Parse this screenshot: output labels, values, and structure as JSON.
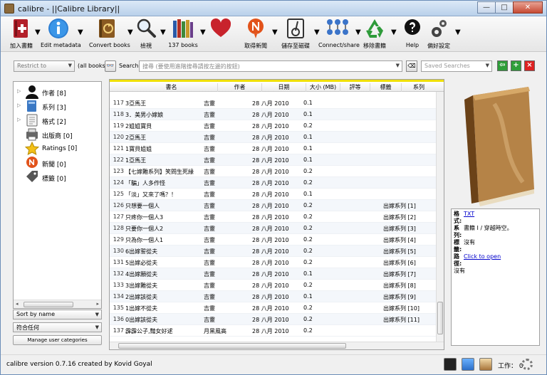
{
  "window": {
    "title": "calibre - ||Calibre Library||",
    "buttons": [
      "—",
      "□",
      "✕"
    ]
  },
  "toolbar": [
    {
      "id": "add-books",
      "label": "加入書籍",
      "icon": "add-book-icon",
      "dropdown": true
    },
    {
      "id": "edit-metadata",
      "label": "Edit metadata",
      "icon": "info-icon",
      "dropdown": true
    },
    {
      "id": "convert-books",
      "label": "Convert books",
      "icon": "convert-book-icon",
      "dropdown": true
    },
    {
      "id": "view",
      "label": "檢視",
      "icon": "magnifier-icon",
      "dropdown": true
    },
    {
      "id": "library",
      "label": "137 books",
      "icon": "bookshelf-icon",
      "dropdown": true
    },
    {
      "id": "donate",
      "label": "",
      "icon": "heart-icon",
      "dropdown": false
    },
    {
      "id": "fetch-news",
      "label": "取得新聞",
      "icon": "news-icon",
      "dropdown": true
    },
    {
      "id": "save-to-disk",
      "label": "儲存至磁碟",
      "icon": "save-disk-icon",
      "dropdown": true
    },
    {
      "id": "connect-share",
      "label": "Connect/share",
      "icon": "network-icon",
      "dropdown": true
    },
    {
      "id": "remove-books",
      "label": "移除書籍",
      "icon": "recycle-icon",
      "dropdown": true
    },
    {
      "id": "help",
      "label": "Help",
      "icon": "help-icon",
      "dropdown": false
    },
    {
      "id": "preferences",
      "label": "偏好設定",
      "icon": "gear-icon",
      "dropdown": true
    }
  ],
  "search": {
    "restrict_to": "Restrict to",
    "all_books": "(all books)",
    "label": "Search:",
    "placeholder": "搜尋 (要使用進階搜尋請按左邊的按鈕)",
    "saved_searches": "Saved Searches"
  },
  "tag_browser": [
    {
      "label": "作者 [8]",
      "icon": "person-icon",
      "expandable": true
    },
    {
      "label": "系列 [3]",
      "icon": "series-icon",
      "expandable": true
    },
    {
      "label": "格式 [2]",
      "icon": "format-icon",
      "expandable": true
    },
    {
      "label": "出版商 [0]",
      "icon": "publisher-icon",
      "expandable": false
    },
    {
      "label": "Ratings [0]",
      "icon": "star-icon",
      "expandable": false
    },
    {
      "label": "新聞 [0]",
      "icon": "news-icon",
      "expandable": false
    },
    {
      "label": "標籤 [0]",
      "icon": "tag-icon",
      "expandable": false
    }
  ],
  "left_controls": {
    "sort_by": "Sort by name",
    "match": "符合任何",
    "manage": "Manage user categories"
  },
  "columns": [
    "書名",
    "作者",
    "日期",
    "大小 (MB)",
    "評等",
    "標籤",
    "系列"
  ],
  "rows": [
    {
      "n": "117",
      "title": "3亞馬王",
      "author": "吉靈",
      "date": "28 八月 2010",
      "size": "0.1",
      "series": ""
    },
    {
      "n": "118",
      "title": "3．美男小嫁娘",
      "author": "吉靈",
      "date": "28 八月 2010",
      "size": "0.1",
      "series": ""
    },
    {
      "n": "119",
      "title": "2姐姐寶貝",
      "author": "吉靈",
      "date": "28 八月 2010",
      "size": "0.2",
      "series": ""
    },
    {
      "n": "120",
      "title": "2亞馬王",
      "author": "吉靈",
      "date": "28 八月 2010",
      "size": "0.1",
      "series": ""
    },
    {
      "n": "121",
      "title": "1寶貝姐姐",
      "author": "吉靈",
      "date": "28 八月 2010",
      "size": "0.1",
      "series": ""
    },
    {
      "n": "122",
      "title": "1亞馬王",
      "author": "吉靈",
      "date": "28 八月 2010",
      "size": "0.1",
      "series": ""
    },
    {
      "n": "123",
      "title": "【七嫁難系列】笑問生死緣",
      "author": "吉靈",
      "date": "28 八月 2010",
      "size": "0.2",
      "series": ""
    },
    {
      "n": "124",
      "title": "「騙」人多作怪",
      "author": "吉靈",
      "date": "28 八月 2010",
      "size": "0.2",
      "series": ""
    },
    {
      "n": "125",
      "title": "「淡」又來了嗎？！",
      "author": "吉靈",
      "date": "28 八月 2010",
      "size": "0.1",
      "series": ""
    },
    {
      "n": "126",
      "title": "只想要一個人",
      "author": "吉靈",
      "date": "28 八月 2010",
      "size": "0.2",
      "series": "出嫁系列 [1]"
    },
    {
      "n": "127",
      "title": "只疼你一個人3",
      "author": "吉靈",
      "date": "28 八月 2010",
      "size": "0.2",
      "series": "出嫁系列 [2]"
    },
    {
      "n": "128",
      "title": "只要你一個人2",
      "author": "吉靈",
      "date": "28 八月 2010",
      "size": "0.2",
      "series": "出嫁系列 [3]"
    },
    {
      "n": "129",
      "title": "只為你一個人1",
      "author": "吉靈",
      "date": "28 八月 2010",
      "size": "0.2",
      "series": "出嫁系列 [4]"
    },
    {
      "n": "130",
      "title": "6出嫁誓從夫",
      "author": "吉靈",
      "date": "28 八月 2010",
      "size": "0.2",
      "series": "出嫁系列 [5]"
    },
    {
      "n": "131",
      "title": "5出嫁必從夫",
      "author": "吉靈",
      "date": "28 八月 2010",
      "size": "0.2",
      "series": "出嫁系列 [6]"
    },
    {
      "n": "132",
      "title": "4出嫁願從夫",
      "author": "吉靈",
      "date": "28 八月 2010",
      "size": "0.1",
      "series": "出嫁系列 [7]"
    },
    {
      "n": "133",
      "title": "3出嫁難從夫",
      "author": "吉靈",
      "date": "28 八月 2010",
      "size": "0.2",
      "series": "出嫁系列 [8]"
    },
    {
      "n": "134",
      "title": "2出嫁該從夫",
      "author": "吉靈",
      "date": "28 八月 2010",
      "size": "0.1",
      "series": "出嫁系列 [9]"
    },
    {
      "n": "135",
      "title": "1出嫁不從夫",
      "author": "吉靈",
      "date": "28 八月 2010",
      "size": "0.2",
      "series": "出嫁系列 [10]"
    },
    {
      "n": "136",
      "title": "0出嫁該從夫",
      "author": "吉靈",
      "date": "28 八月 2010",
      "size": "0.2",
      "series": "出嫁系列 [11]"
    },
    {
      "n": "137",
      "title": "霹霹公子,豔女好逑",
      "author": "月黑風高",
      "date": "28 八月 2010",
      "size": "0.2",
      "series": ""
    }
  ],
  "details": {
    "format_label": "格式:",
    "format_value": "TXT",
    "series_label": "系列:",
    "series_value": "書籍 I / 穿越時空。",
    "tags_label": "標籤:",
    "tags_value": "沒有",
    "path_label": "路徑:",
    "path_value": "Click to open",
    "comments_value": "沒有"
  },
  "status": {
    "text": "calibre version 0.7.16 created by Kovid Goyal",
    "jobs": "工作： 0"
  },
  "colors": {
    "accent_yellow": "#f0e000",
    "title_bar": "#b9d0ea",
    "link": "#0000cc"
  }
}
